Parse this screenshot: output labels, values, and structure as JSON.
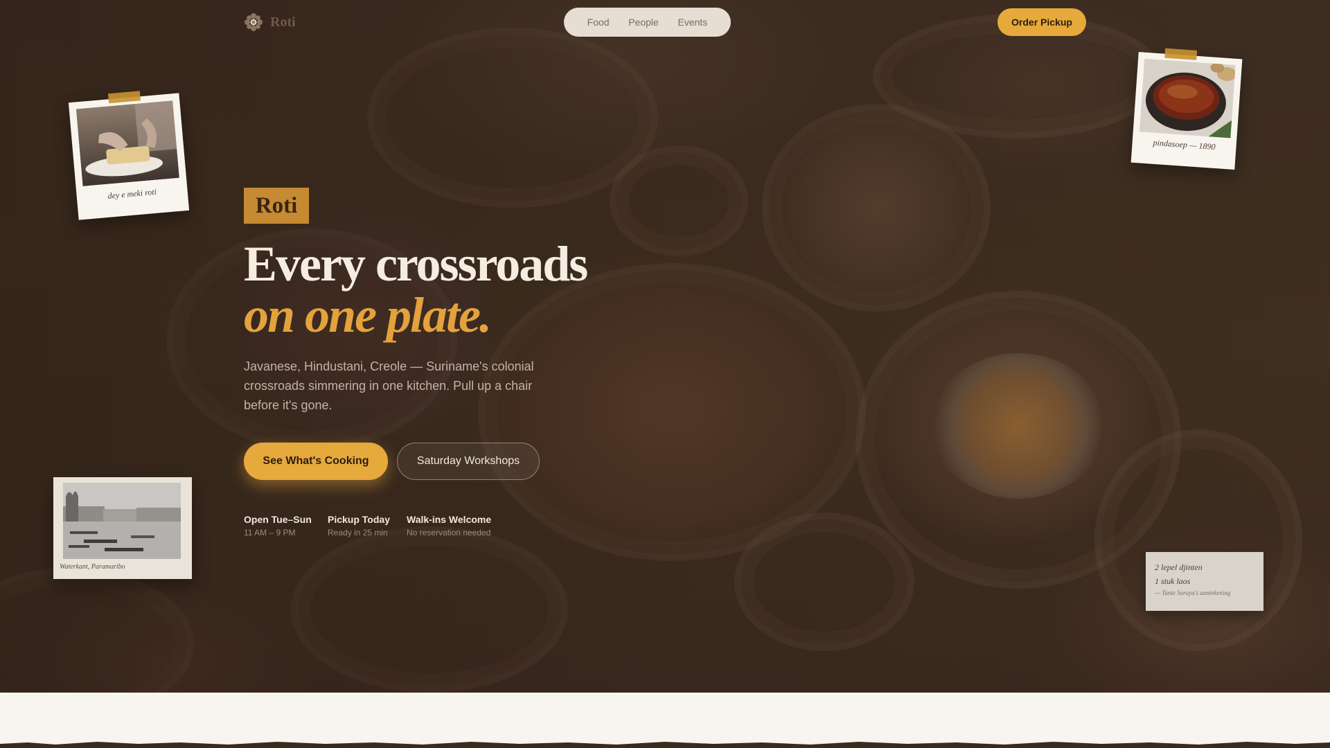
{
  "brand": {
    "name": "Roti",
    "logo_icon": "flower-emblem-icon"
  },
  "nav": {
    "links": [
      "Food",
      "People",
      "Events"
    ]
  },
  "header": {
    "order_label": "Order Pickup"
  },
  "hero": {
    "tag": "Roti",
    "headline": "Every crossroads",
    "headline_accent": "on one plate.",
    "lede": "Javanese, Hindustani, Creole — Suriname's colonial crossroads simmering in one kitchen. Pull up a chair before it's gone.",
    "primary_cta": "See What's Cooking",
    "secondary_cta": "Saturday Workshops"
  },
  "facts": [
    {
      "title": "Open Tue–Sun",
      "sub": "11 AM – 9 PM"
    },
    {
      "title": "Pickup Today",
      "sub": "Ready in 25 min"
    },
    {
      "title": "Walk-ins Welcome",
      "sub": "No reservation needed"
    }
  ],
  "polaroids": {
    "roti": {
      "caption": "dey e meki roti"
    },
    "soup": {
      "caption": "pindasoep — 1890"
    },
    "harbor": {
      "caption": "Waterkant, Paramaribo"
    }
  },
  "note": {
    "lines": [
      "2 lepel djinten",
      "1 stuk laos"
    ],
    "signature": "— Tante Soraya's aantekening"
  },
  "colors": {
    "accent": "#e6a93b",
    "background": "#3d2c22",
    "cream": "#f8f5ef"
  }
}
